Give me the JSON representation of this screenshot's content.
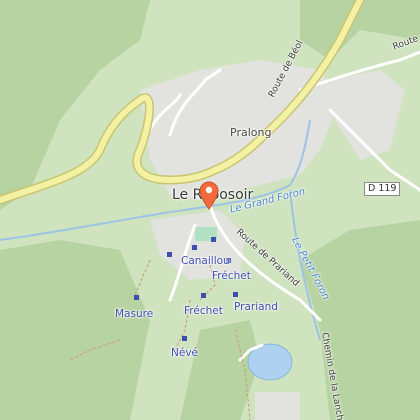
{
  "map": {
    "colors": {
      "background": "#cfe3bf",
      "forest": "#b7d3a2",
      "settlement": "#e2e2de",
      "main_road_fill": "#f3f2a4",
      "main_road_casing": "#c9c56f",
      "minor_road": "#ffffff",
      "river": "#9cc3e6",
      "lake": "#aed1ef",
      "marker": "#f26a3c",
      "transit_stop": "#3f4db0"
    },
    "labels": {
      "village": "Le Reposoir",
      "pralong": "Pralong",
      "canaillou": "Canaillou",
      "frechet_upper": "Fréchet",
      "frechet_lower": "Fréchet",
      "masure": "Masure",
      "prariand": "Prariand",
      "neve": "Névé"
    },
    "roads": {
      "route_de_beol": "Route de Béol",
      "route_de_prariand": "Route de Prariand",
      "route_top_right": "Route d",
      "chemin_de_la_lanche": "Chemin de la Lanche",
      "d119": "D 119"
    },
    "water": {
      "grand_foron": "Le Grand Foron",
      "petit_foron": "Le Petit Foron"
    },
    "icons": {
      "marker": "location-pin-icon",
      "stop": "bus-stop-icon"
    }
  }
}
